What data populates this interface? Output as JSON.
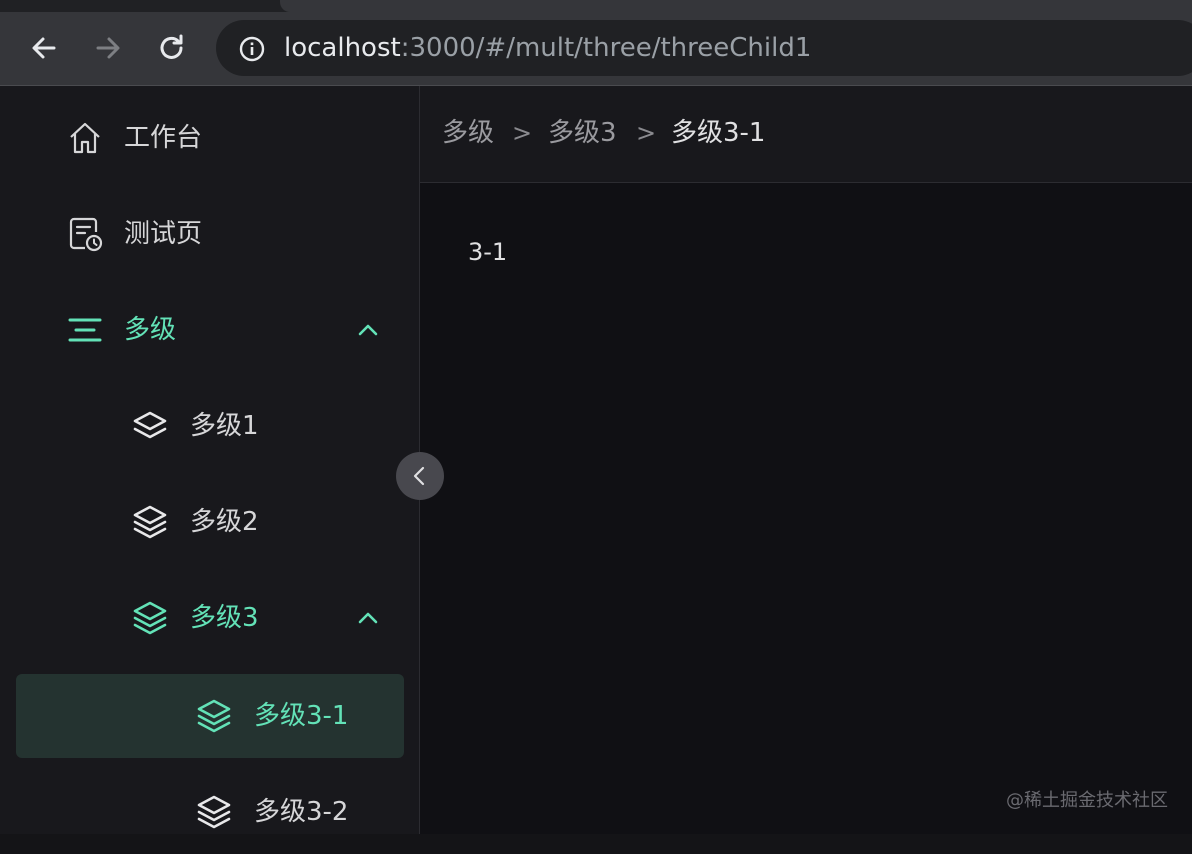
{
  "browser": {
    "url_host": "localhost",
    "url_path": ":3000/#/mult/three/threeChild1"
  },
  "sidebar": {
    "items": [
      {
        "label": "工作台",
        "icon": "home-icon"
      },
      {
        "label": "测试页",
        "icon": "document-clock-icon"
      },
      {
        "label": "多级",
        "icon": "menu-lines-icon",
        "expanded": true
      },
      {
        "label": "多级1",
        "icon": "layers-icon"
      },
      {
        "label": "多级2",
        "icon": "layers-icon"
      },
      {
        "label": "多级3",
        "icon": "layers-icon",
        "expanded": true
      },
      {
        "label": "多级3-1",
        "icon": "layers-icon",
        "selected": true
      },
      {
        "label": "多级3-2",
        "icon": "layers-icon"
      }
    ]
  },
  "breadcrumb": {
    "items": [
      "多级",
      "多级3",
      "多级3-1"
    ],
    "separator": ">"
  },
  "content": {
    "text": "3-1"
  },
  "watermark": "@稀土掘金技术社区",
  "colors": {
    "accent": "#63e2b7",
    "sidebar_bg": "#18181c",
    "selected_bg": "#243330",
    "main_bg": "#101014"
  }
}
